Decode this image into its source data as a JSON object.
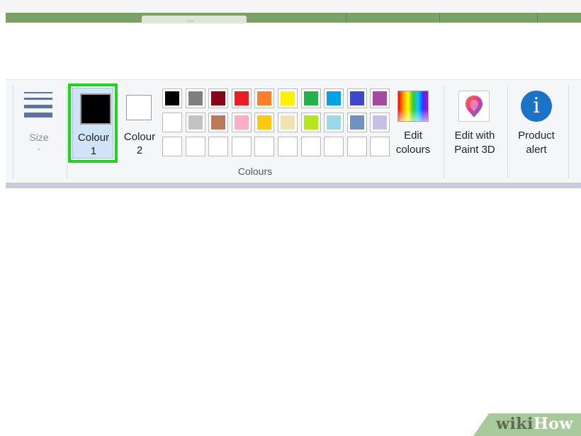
{
  "ribbon": {
    "size_label": "Size",
    "size_dropdown_glyph": "⌄",
    "colour1_label_line1": "Colour",
    "colour1_label_line2": "1",
    "colour2_label_line1": "Colour",
    "colour2_label_line2": "2",
    "edit_colours_line1": "Edit",
    "edit_colours_line2": "colours",
    "paint3d_line1": "Edit with",
    "paint3d_line2": "Paint 3D",
    "product_alert_line1": "Product",
    "product_alert_line2": "alert",
    "group_label": "Colours",
    "info_icon_glyph": "i"
  },
  "colours": {
    "colour1_value": "#000000",
    "colour2_value": "#ffffff",
    "selection_highlight": "#22d31e",
    "palette_row1": [
      "#000000",
      "#7f7f7f",
      "#880015",
      "#ed1c24",
      "#ff7f27",
      "#fff200",
      "#22b14c",
      "#00a2e8",
      "#3f48cc",
      "#a349a4"
    ],
    "palette_row2": [
      "#ffffff",
      "#c3c3c3",
      "#b97a57",
      "#ffaec9",
      "#ffc90e",
      "#efe4b0",
      "#b5e61d",
      "#99d9ea",
      "#7092be",
      "#c8bfe7"
    ],
    "palette_row3_count_empty": 10
  },
  "icons": {
    "size": "line-thickness-icon",
    "edit_colours": "rainbow-colour-picker-icon",
    "paint3d": "paint-3d-icon",
    "product_alert": "info-icon"
  },
  "watermark": {
    "part1": "wiki",
    "part2": "How"
  }
}
